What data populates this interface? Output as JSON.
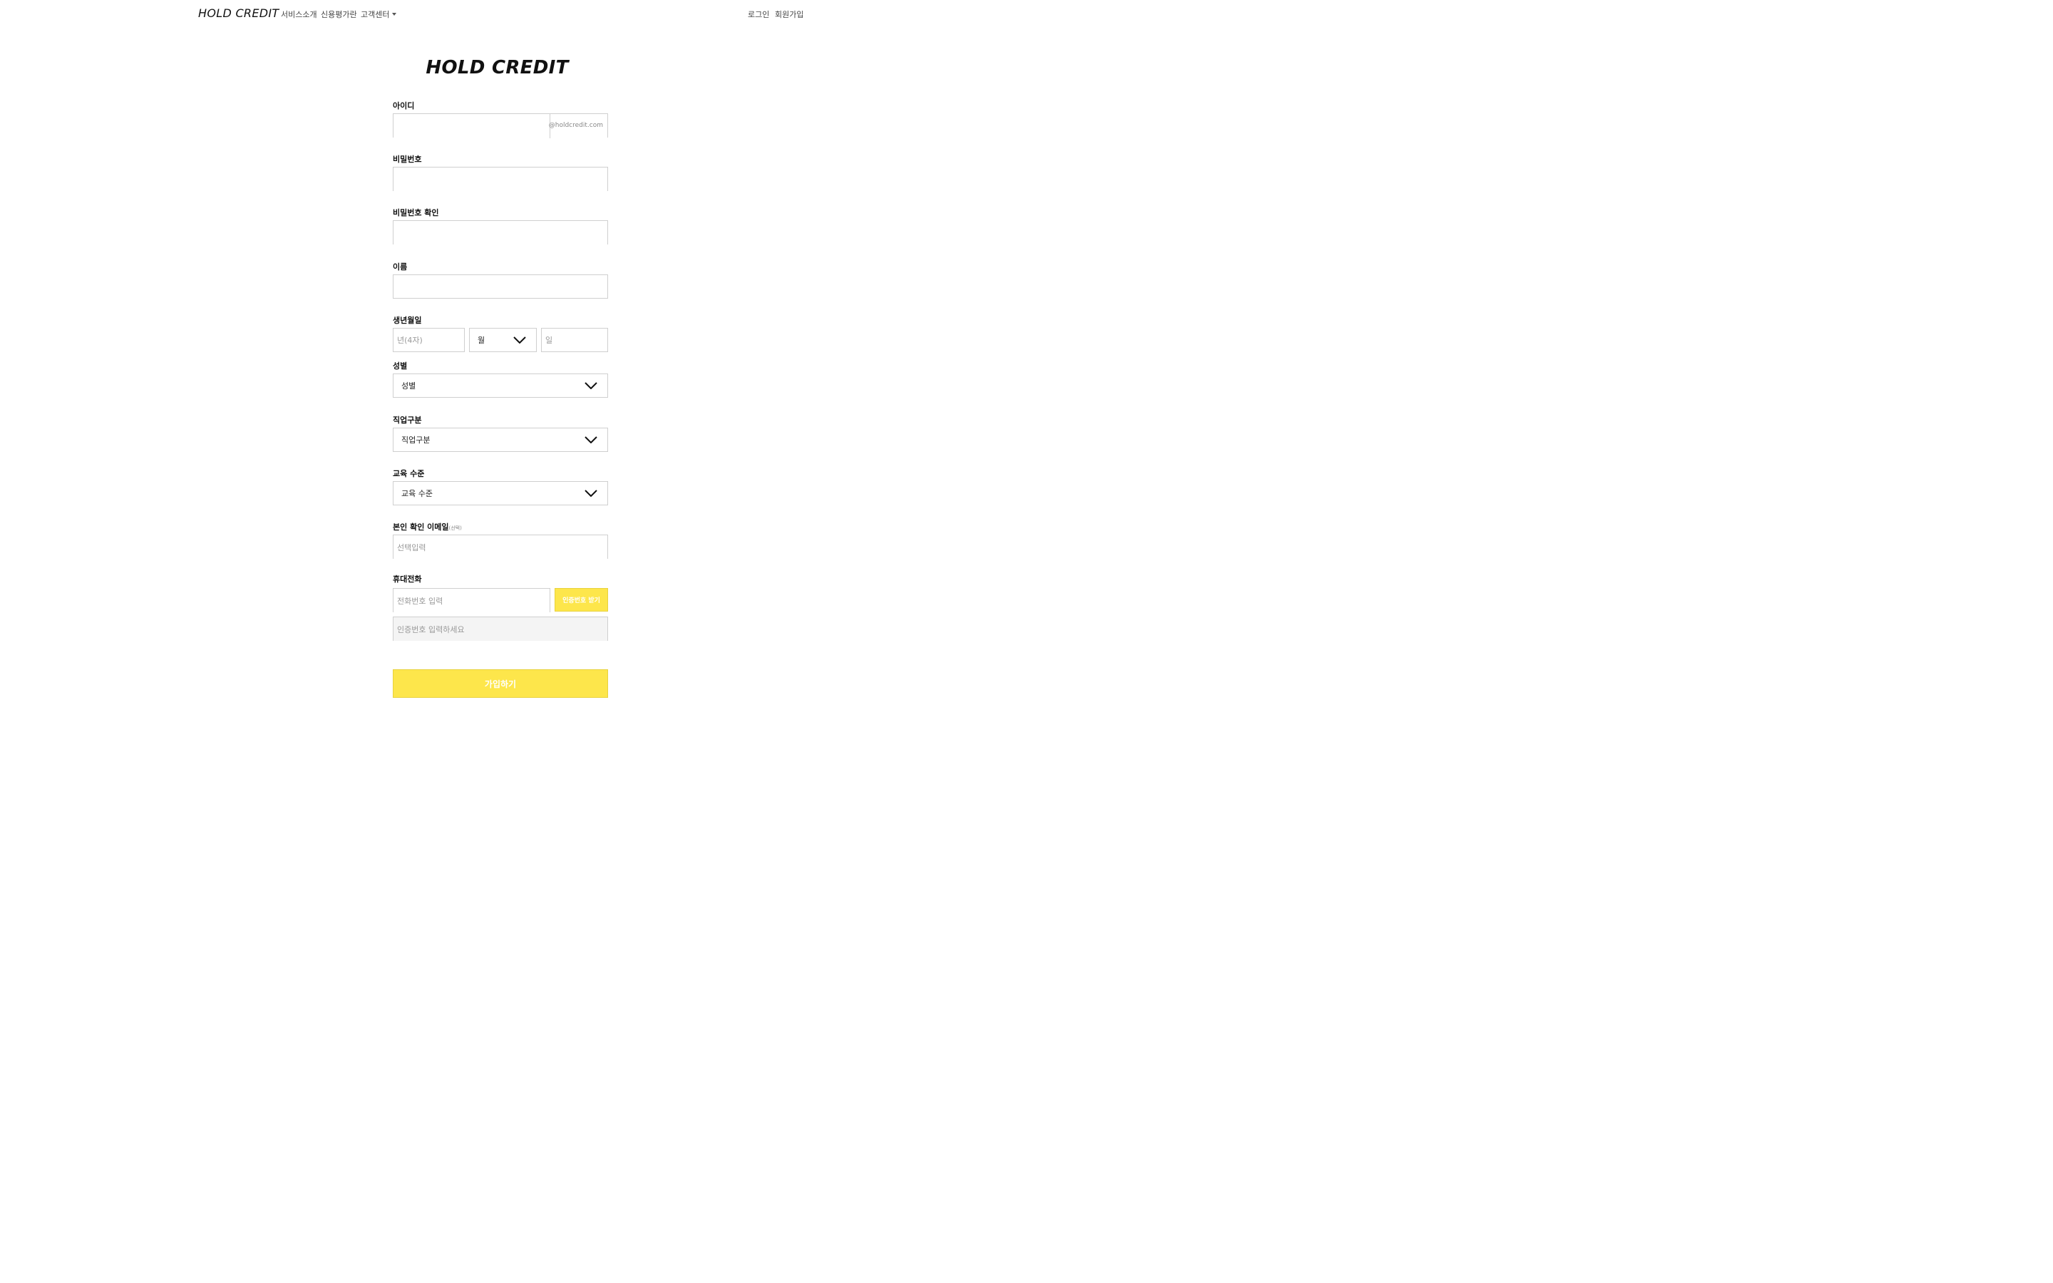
{
  "nav": {
    "brand": "HOLD CREDIT",
    "links": [
      "서비스소개",
      "신용평가란",
      "고객센터"
    ],
    "login": "로그인",
    "signup": "회원가입"
  },
  "form": {
    "title": "HOLD CREDIT",
    "id": {
      "label": "아이디",
      "value": "",
      "suffix": "@holdcredit.com"
    },
    "password": {
      "label": "비밀번호",
      "value": ""
    },
    "password_confirm": {
      "label": "비밀번호 확인",
      "value": ""
    },
    "name": {
      "label": "이름",
      "value": ""
    },
    "birth": {
      "label": "생년월일",
      "year_placeholder": "년(4자)",
      "month_selected": "월",
      "day_placeholder": "일"
    },
    "gender": {
      "label": "성별",
      "selected": "성별"
    },
    "job": {
      "label": "직업구분",
      "selected": "직업구분"
    },
    "education": {
      "label": "교육 수준",
      "selected": "교육 수준"
    },
    "email": {
      "label": "본인 확인 이메일",
      "optional": "(선택)",
      "placeholder": "선택입력"
    },
    "phone": {
      "label": "휴대전화",
      "placeholder": "전화번호 입력",
      "send_code_button": "인증번호 받기",
      "code_placeholder": "인증번호 입력하세요"
    },
    "submit": "가입하기"
  },
  "colors": {
    "accent": "#fde64b",
    "border": "#cfcfcf"
  },
  "icons": {
    "select_arrow": "chevron-down-icon",
    "dropdown_caret": "caret-down-icon"
  }
}
